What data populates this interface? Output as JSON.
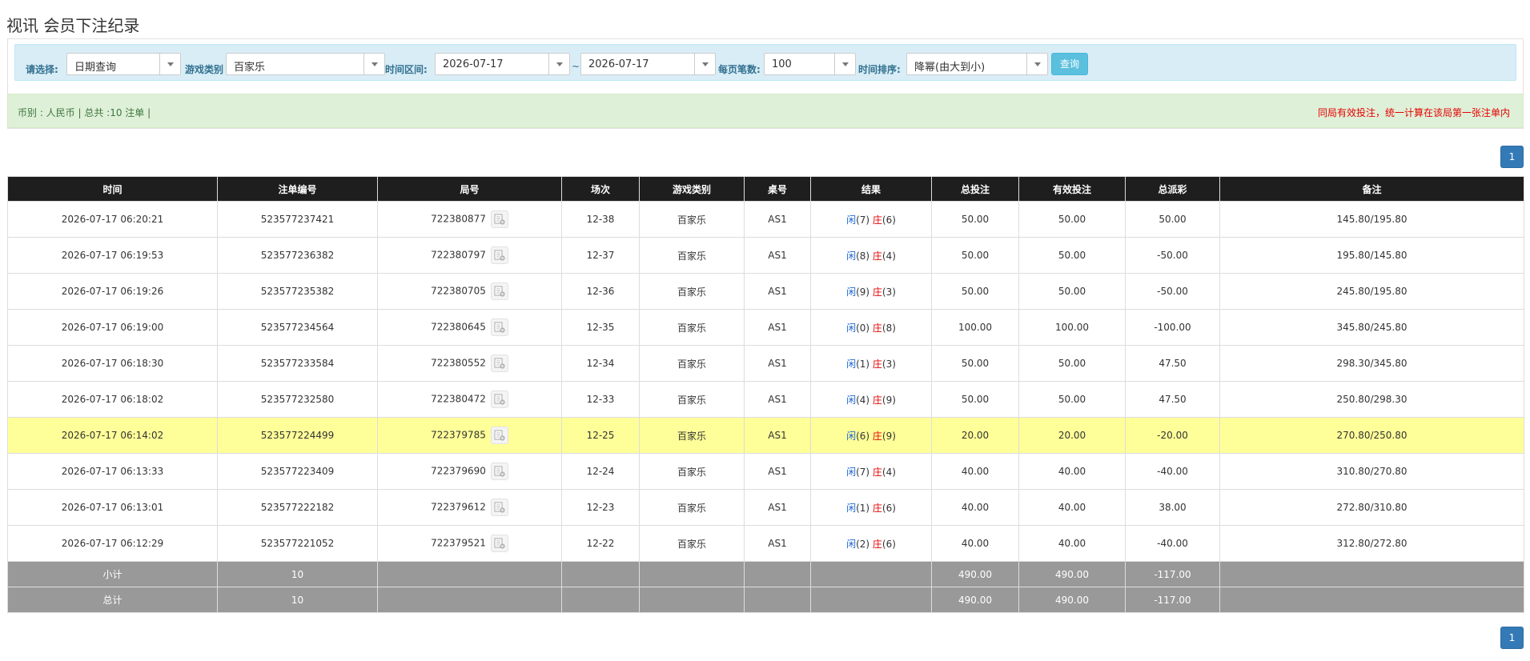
{
  "page_title": "视讯 会员下注纪录",
  "filters": {
    "select_label": "请选择:",
    "select_value": "日期查询",
    "game_type_label": "游戏类别",
    "game_type_value": "百家乐",
    "time_range_label": "时间区间:",
    "date_from": "2026-07-17",
    "tilde": "~",
    "date_to": "2026-07-17",
    "per_page_label": "每页笔数:",
    "per_page_value": "100",
    "sort_label": "时间排序:",
    "sort_value": "降幂(由大到小)",
    "query_button": "查询"
  },
  "info": {
    "left": "币别 : 人民币 | 总共 :10 注单 |",
    "right": "同局有效投注，统一计算在该局第一张注单内"
  },
  "pager": {
    "page": "1"
  },
  "table": {
    "headers": [
      "时间",
      "注单编号",
      "局号",
      "场次",
      "游戏类别",
      "桌号",
      "结果",
      "总投注",
      "有效投注",
      "总派彩",
      "备注"
    ],
    "rows": [
      {
        "time": "2026-07-17 06:20:21",
        "bet_no": "523577237421",
        "round": "722380877",
        "session": "12-38",
        "game": "百家乐",
        "table_no": "AS1",
        "player_label": "闲",
        "player": "(7)",
        "banker_label": "庄",
        "banker": "(6)",
        "total_bet": "50.00",
        "valid_bet": "50.00",
        "payout": "50.00",
        "payout_neg": false,
        "note": "145.80/195.80",
        "highlight": false
      },
      {
        "time": "2026-07-17 06:19:53",
        "bet_no": "523577236382",
        "round": "722380797",
        "session": "12-37",
        "game": "百家乐",
        "table_no": "AS1",
        "player_label": "闲",
        "player": "(8)",
        "banker_label": "庄",
        "banker": "(4)",
        "total_bet": "50.00",
        "valid_bet": "50.00",
        "payout": "-50.00",
        "payout_neg": true,
        "note": "195.80/145.80",
        "highlight": false
      },
      {
        "time": "2026-07-17 06:19:26",
        "bet_no": "523577235382",
        "round": "722380705",
        "session": "12-36",
        "game": "百家乐",
        "table_no": "AS1",
        "player_label": "闲",
        "player": "(9)",
        "banker_label": "庄",
        "banker": "(3)",
        "total_bet": "50.00",
        "valid_bet": "50.00",
        "payout": "-50.00",
        "payout_neg": true,
        "note": "245.80/195.80",
        "highlight": false
      },
      {
        "time": "2026-07-17 06:19:00",
        "bet_no": "523577234564",
        "round": "722380645",
        "session": "12-35",
        "game": "百家乐",
        "table_no": "AS1",
        "player_label": "闲",
        "player": "(0)",
        "banker_label": "庄",
        "banker": "(8)",
        "total_bet": "100.00",
        "valid_bet": "100.00",
        "payout": "-100.00",
        "payout_neg": true,
        "note": "345.80/245.80",
        "highlight": false
      },
      {
        "time": "2026-07-17 06:18:30",
        "bet_no": "523577233584",
        "round": "722380552",
        "session": "12-34",
        "game": "百家乐",
        "table_no": "AS1",
        "player_label": "闲",
        "player": "(1)",
        "banker_label": "庄",
        "banker": "(3)",
        "total_bet": "50.00",
        "valid_bet": "50.00",
        "payout": "47.50",
        "payout_neg": false,
        "note": "298.30/345.80",
        "highlight": false
      },
      {
        "time": "2026-07-17 06:18:02",
        "bet_no": "523577232580",
        "round": "722380472",
        "session": "12-33",
        "game": "百家乐",
        "table_no": "AS1",
        "player_label": "闲",
        "player": "(4)",
        "banker_label": "庄",
        "banker": "(9)",
        "total_bet": "50.00",
        "valid_bet": "50.00",
        "payout": "47.50",
        "payout_neg": false,
        "note": "250.80/298.30",
        "highlight": false
      },
      {
        "time": "2026-07-17 06:14:02",
        "bet_no": "523577224499",
        "round": "722379785",
        "session": "12-25",
        "game": "百家乐",
        "table_no": "AS1",
        "player_label": "闲",
        "player": "(6)",
        "banker_label": "庄",
        "banker": "(9)",
        "total_bet": "20.00",
        "valid_bet": "20.00",
        "payout": "-20.00",
        "payout_neg": true,
        "note": "270.80/250.80",
        "highlight": true
      },
      {
        "time": "2026-07-17 06:13:33",
        "bet_no": "523577223409",
        "round": "722379690",
        "session": "12-24",
        "game": "百家乐",
        "table_no": "AS1",
        "player_label": "闲",
        "player": "(7)",
        "banker_label": "庄",
        "banker": "(4)",
        "total_bet": "40.00",
        "valid_bet": "40.00",
        "payout": "-40.00",
        "payout_neg": true,
        "note": "310.80/270.80",
        "highlight": false
      },
      {
        "time": "2026-07-17 06:13:01",
        "bet_no": "523577222182",
        "round": "722379612",
        "session": "12-23",
        "game": "百家乐",
        "table_no": "AS1",
        "player_label": "闲",
        "player": "(1)",
        "banker_label": "庄",
        "banker": "(6)",
        "total_bet": "40.00",
        "valid_bet": "40.00",
        "payout": "38.00",
        "payout_neg": false,
        "note": "272.80/310.80",
        "highlight": false
      },
      {
        "time": "2026-07-17 06:12:29",
        "bet_no": "523577221052",
        "round": "722379521",
        "session": "12-22",
        "game": "百家乐",
        "table_no": "AS1",
        "player_label": "闲",
        "player": "(2)",
        "banker_label": "庄",
        "banker": "(6)",
        "total_bet": "40.00",
        "valid_bet": "40.00",
        "payout": "-40.00",
        "payout_neg": true,
        "note": "312.80/272.80",
        "highlight": false
      }
    ],
    "subtotal": {
      "label": "小计",
      "count": "10",
      "total_bet": "490.00",
      "valid_bet": "490.00",
      "payout": "-117.00"
    },
    "grand_total": {
      "label": "总计",
      "count": "10",
      "total_bet": "490.00",
      "valid_bet": "490.00",
      "payout": "-117.00"
    }
  },
  "icons": {
    "round_record": "round-record-icon",
    "dropdown": "chevron-down-icon"
  },
  "colors": {
    "header_bg": "#1e1e1e",
    "highlight_row": "#ffff99",
    "positive_blue": "#1a66d6",
    "negative_red": "#e60000",
    "sum_row_bg": "#999999",
    "filter_bg": "#d9edf7",
    "info_bg": "#dff0d8",
    "pager_blue": "#337ab7"
  }
}
